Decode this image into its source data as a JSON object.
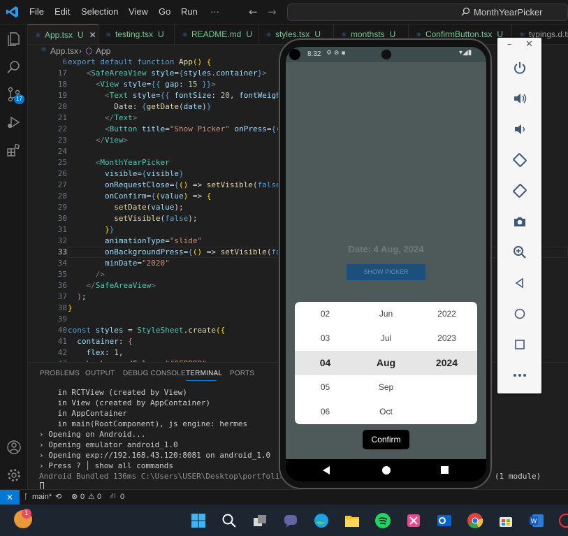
{
  "menu": [
    "File",
    "Edit",
    "Selection",
    "View",
    "Go",
    "Run",
    "···"
  ],
  "search": {
    "text": "MonthYearPicker"
  },
  "tabs": [
    {
      "label": "App.tsx",
      "badge": "U",
      "active": true,
      "color": "#dddddd"
    },
    {
      "label": "testing.tsx",
      "badge": "U",
      "active": false,
      "color": "#9d9d9d"
    },
    {
      "label": "README.md",
      "badge": "U",
      "active": false,
      "color": "#9d9d9d"
    },
    {
      "label": "styles.tsx",
      "badge": "U",
      "active": false,
      "color": "#9d9d9d"
    },
    {
      "label": "monthsts",
      "badge": "U",
      "active": false,
      "color": "#9d9d9d"
    },
    {
      "label": "ConfirmButton.tsx",
      "badge": "U",
      "active": false,
      "color": "#9d9d9d"
    },
    {
      "label": "typings.d.ts",
      "badge": "",
      "active": false,
      "color": "#9d9d9d"
    }
  ],
  "breadcrumb": {
    "file": "App.tsx",
    "symbol": "App"
  },
  "scm_badge": "17",
  "code_lines": [
    {
      "n": "6",
      "html": "<span class='k'>export default function</span> <span class='f'>App</span><span class='b'>()</span> <span class='b'>{</span>"
    },
    {
      "n": "17",
      "html": "    <span class='g'>&lt;</span><span class='t'>SafeAreaView</span> <span class='a'>style</span>=<span class='k'>{</span><span class='a'>styles</span>.<span class='a'>container</span><span class='k'>}</span><span class='g'>&gt;</span>"
    },
    {
      "n": "18",
      "html": "      <span class='g'>&lt;</span><span class='t'>View</span> <span class='a'>style</span>=<span class='k'>{{</span> <span class='a'>gap</span>: <span class='n'>15</span> <span class='k'>}}</span><span class='g'>&gt;</span>"
    },
    {
      "n": "19",
      "html": "        <span class='g'>&lt;</span><span class='t'>Text</span> <span class='a'>style</span>=<span class='k'>{{</span> <span class='a'>fontSize</span>: <span class='n'>20</span>, <span class='a'>fontWeight</span>"
    },
    {
      "n": "20",
      "html": "          Date: <span class='k'>{</span><span class='f'>getDate</span>(<span class='a'>date</span>)<span class='k'>}</span>"
    },
    {
      "n": "21",
      "html": "        <span class='g'>&lt;/</span><span class='t'>Text</span><span class='g'>&gt;</span>"
    },
    {
      "n": "22",
      "html": "        <span class='g'>&lt;</span><span class='t'>Button</span> <span class='a'>title</span>=<span class='s'>\"Show Picker\"</span> <span class='a'>onPress</span>=<span class='k'>{</span><span class='b'>()</span>"
    },
    {
      "n": "23",
      "html": "      <span class='g'>&lt;/</span><span class='t'>View</span><span class='g'>&gt;</span>"
    },
    {
      "n": "24",
      "html": ""
    },
    {
      "n": "25",
      "html": "      <span class='g'>&lt;</span><span class='t'>MonthYearPicker</span>"
    },
    {
      "n": "26",
      "html": "        <span class='a'>visible</span>=<span class='k'>{</span><span class='a'>visible</span><span class='k'>}</span>"
    },
    {
      "n": "27",
      "html": "        <span class='a'>onRequestClose</span>=<span class='k'>{</span><span class='b'>()</span> =&gt; <span class='f'>setVisible</span>(<span class='k'>false</span>)"
    },
    {
      "n": "28",
      "html": "        <span class='a'>onConfirm</span>=<span class='k'>{</span><span class='b'>(</span><span class='a'>value</span><span class='b'>)</span> =&gt; <span class='b'>{</span>"
    },
    {
      "n": "29",
      "html": "          <span class='f'>setDate</span>(<span class='a'>value</span>);"
    },
    {
      "n": "30",
      "html": "          <span class='f'>setVisible</span>(<span class='k'>false</span>);"
    },
    {
      "n": "31",
      "html": "        <span class='b'>}</span><span class='k'>}</span>"
    },
    {
      "n": "32",
      "html": "        <span class='a'>animationType</span>=<span class='s'>\"slide\"</span>"
    },
    {
      "n": "33",
      "html": "        <span class='a'>onBackgroundPress</span>=<span class='k'>{</span><span class='b'>()</span> =&gt; <span class='f'>setVisible</span>(<span class='k'>fal</span>"
    },
    {
      "n": "34",
      "html": "        <span class='a'>minDate</span>=<span class='s'>\"2020\"</span>"
    },
    {
      "n": "35",
      "html": "      <span class='g'>/&gt;</span>"
    },
    {
      "n": "36",
      "html": "    <span class='g'>&lt;/</span><span class='t'>SafeAreaView</span><span class='g'>&gt;</span>"
    },
    {
      "n": "37",
      "html": "  <span class='p'>)</span>;"
    },
    {
      "n": "38",
      "html": "<span class='b'>}</span>"
    },
    {
      "n": "39",
      "html": ""
    },
    {
      "n": "40",
      "html": "<span class='k'>const</span> <span class='a'>styles</span> = <span class='t'>StyleSheet</span>.<span class='f'>create</span><span class='b'>({</span>"
    },
    {
      "n": "41",
      "html": "  <span class='a'>container</span>: <span class='p'>{</span>"
    },
    {
      "n": "42",
      "html": "    <span class='a'>flex</span>: <span class='n'>1</span>,"
    },
    {
      "n": "43",
      "html": "    <span class='a'>backgroundColor</span>: <span class='s'>\"#9FBBBB\"</span>,"
    }
  ],
  "panel_tabs": [
    "PROBLEMS",
    "OUTPUT",
    "DEBUG CONSOLE",
    "TERMINAL",
    "PORTS"
  ],
  "terminal_lines": [
    "    in RCTView (created by View)",
    "    in View (created by AppContainer)",
    "    in AppContainer",
    "    in main(RootComponent), js engine: hermes",
    "› Opening on Android...",
    "› Opening emulator android_1.0",
    "› Opening exp://192.168.43.120:8081 on android_1.0",
    "› Press ? │ show all commands",
    "Android Bundled 136ms C:\\Users\\USER\\Desktop\\portfolio-pro",
    "(1 module)"
  ],
  "statusbar": {
    "branch": "main*",
    "errors": "0",
    "warnings": "0",
    "ports": "0"
  },
  "phone": {
    "time": "8:32",
    "date_label": "Date: 4 Aug, 2024",
    "show_picker": "SHOW PICKER",
    "confirm": "Confirm",
    "picker_rows": [
      {
        "month_num": "02",
        "month": "Jun",
        "year": "2022"
      },
      {
        "month_num": "03",
        "month": "Jul",
        "year": "2023"
      },
      {
        "month_num": "04",
        "month": "Aug",
        "year": "2024"
      },
      {
        "month_num": "05",
        "month": "Sep",
        "year": ""
      },
      {
        "month_num": "06",
        "month": "Oct",
        "year": ""
      }
    ],
    "selected_index": 2
  },
  "emulator_controls": [
    "power-icon",
    "volume-up-icon",
    "volume-down-icon",
    "rotate-left-icon",
    "rotate-right-icon",
    "camera-icon",
    "zoom-icon",
    "back-icon",
    "home-icon",
    "overview-icon",
    "more-icon"
  ],
  "taskbar_badge": "1"
}
